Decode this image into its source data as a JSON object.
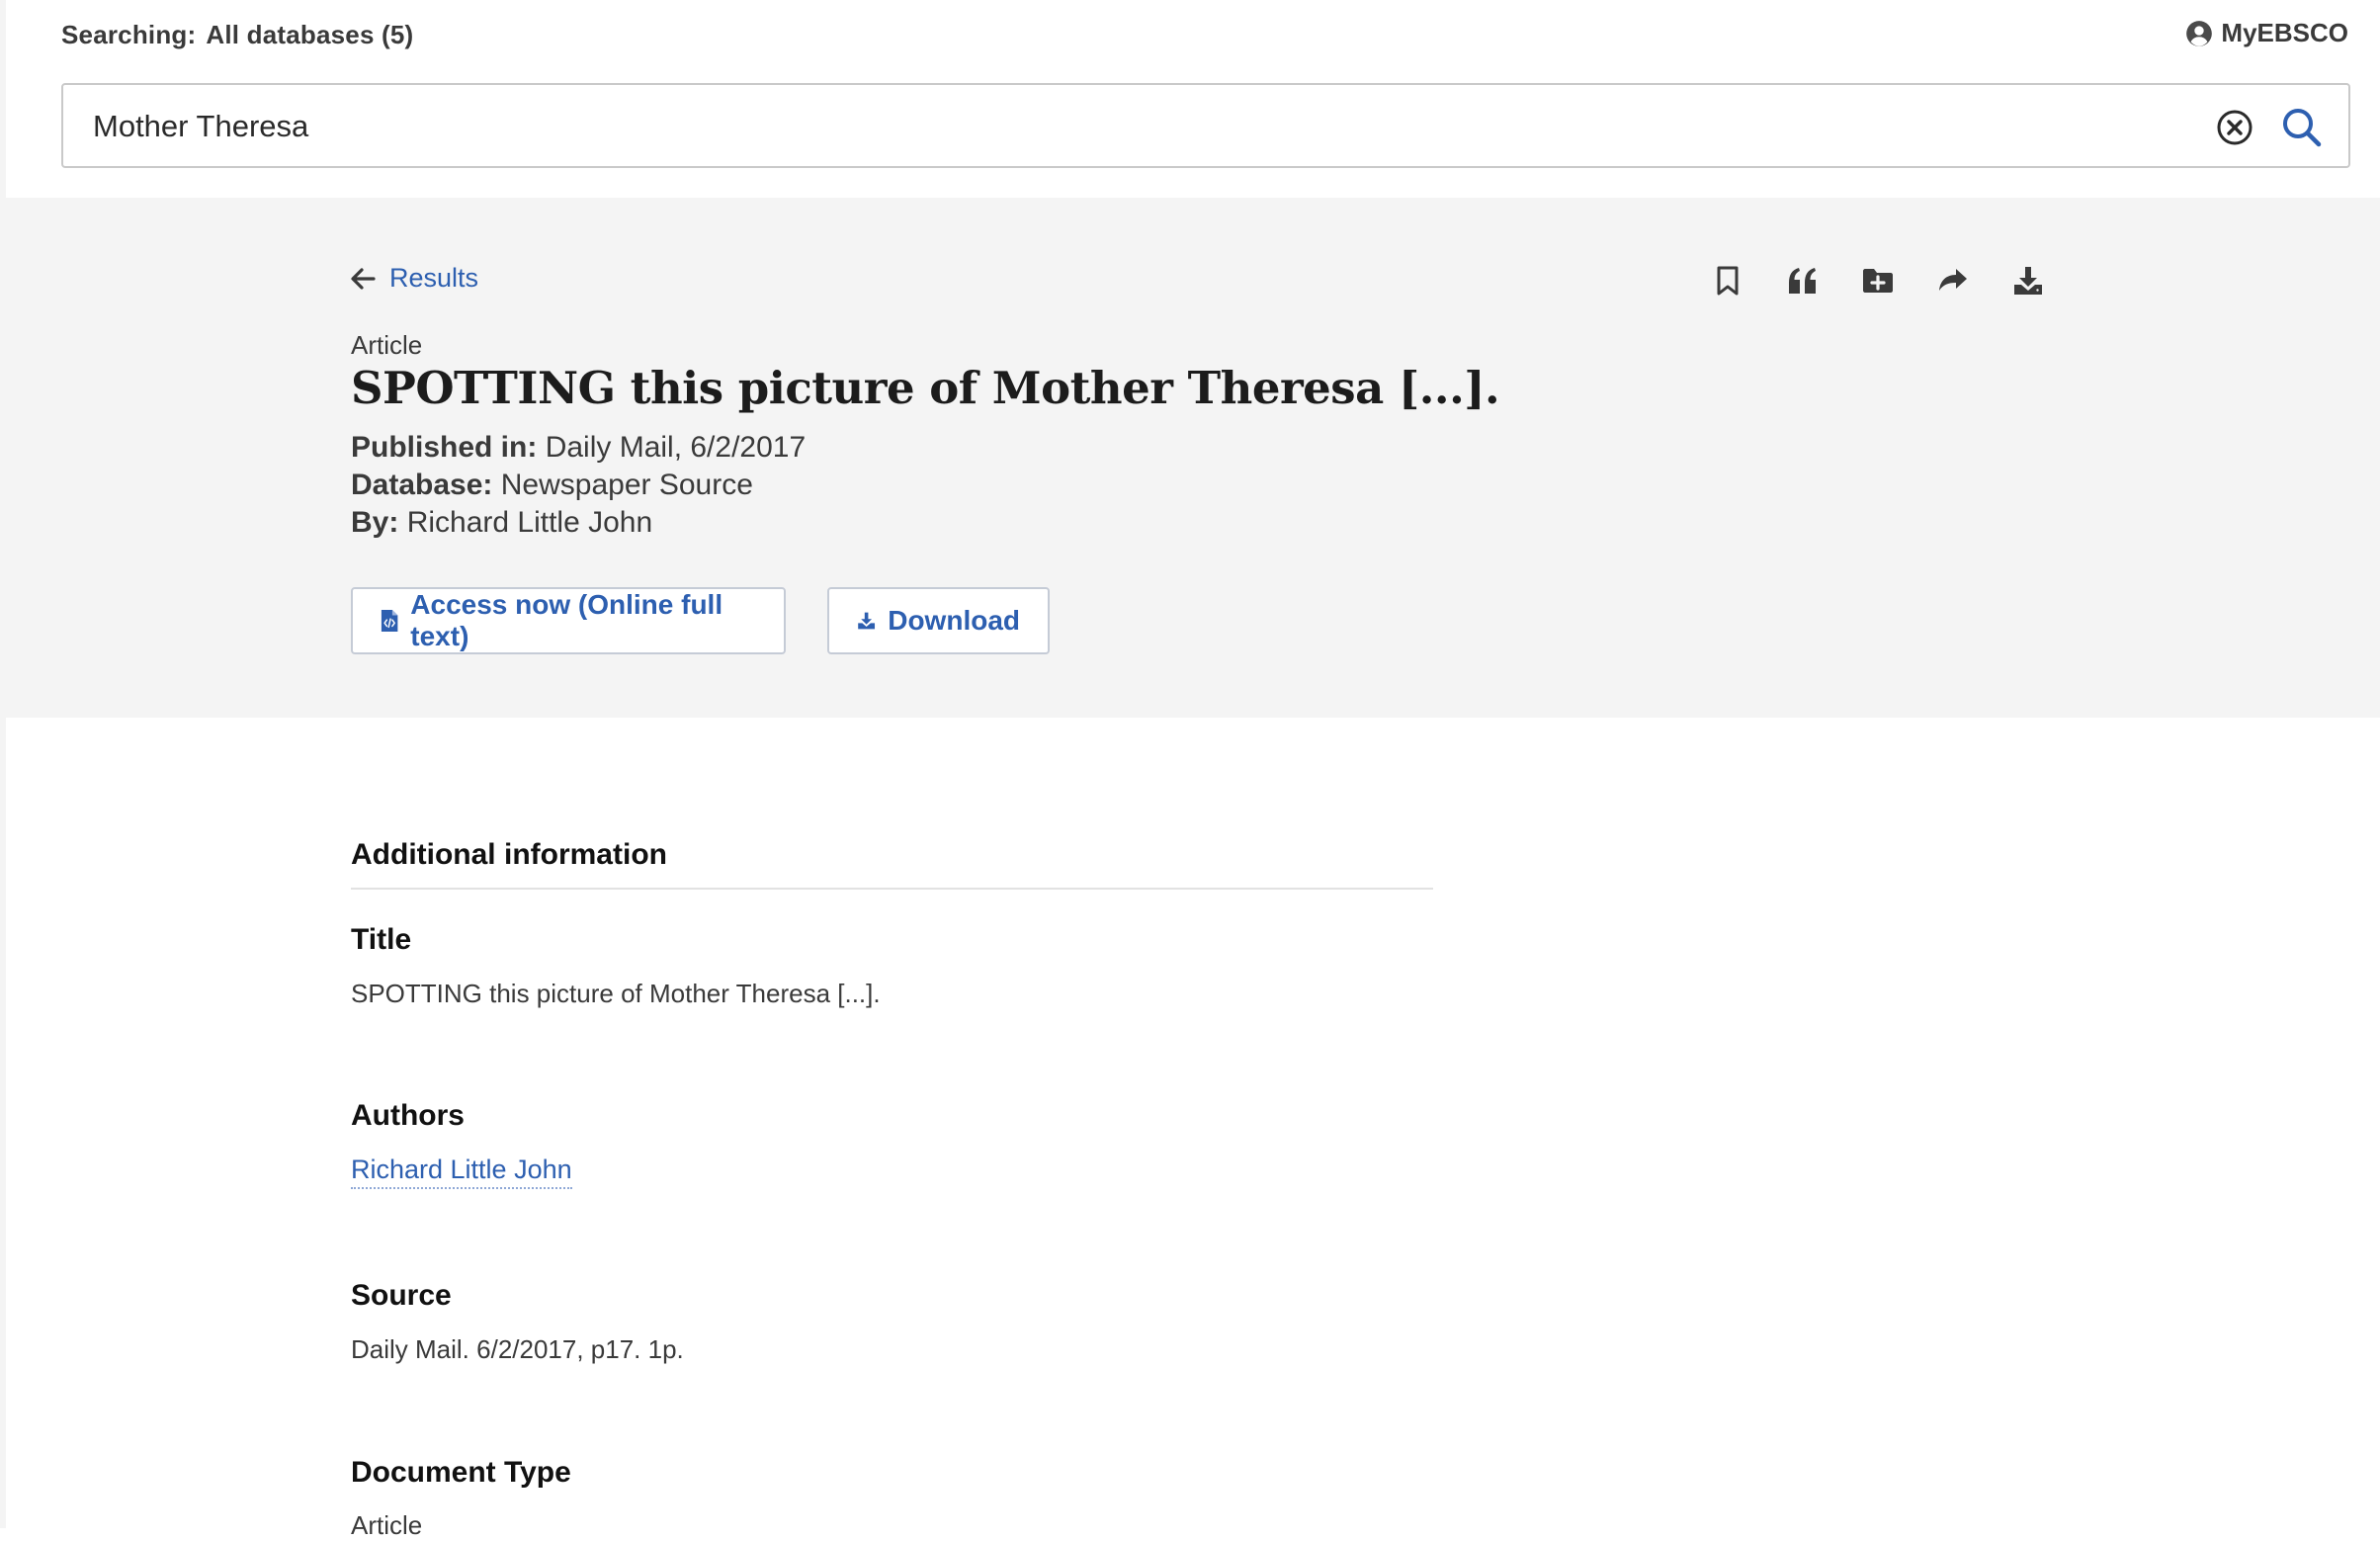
{
  "header": {
    "searching_label": "Searching:",
    "searching_value": "All databases (5)",
    "account_label": "MyEBSCO"
  },
  "search": {
    "query": "Mother Theresa",
    "clear_icon": "clear-circle-icon",
    "search_icon": "search-icon"
  },
  "record": {
    "back_label": "Results",
    "publication_type": "Article",
    "title": "SPOTTING this picture of Mother Theresa [...].",
    "published_in_label": "Published in:",
    "published_in_value": "Daily Mail, 6/2/2017",
    "database_label": "Database:",
    "database_value": "Newspaper Source",
    "by_label": "By:",
    "by_value": "Richard Little John",
    "access_button": "Access now (Online full text)",
    "download_button": "Download",
    "tools": [
      "bookmark-icon",
      "cite-quote-icon",
      "add-to-folder-icon",
      "share-icon",
      "download-icon"
    ]
  },
  "additional_info": {
    "heading": "Additional information",
    "fields": [
      {
        "label": "Title",
        "value": "SPOTTING this picture of Mother Theresa [...]."
      },
      {
        "label": "Authors",
        "value": "Richard Little John"
      },
      {
        "label": "Source",
        "value": "Daily Mail. 6/2/2017, p17. 1p."
      },
      {
        "label": "Document Type",
        "value": "Article"
      }
    ]
  },
  "colors": {
    "accent": "#2d5fb0",
    "hero_background": "#f4f4f4",
    "text": "#3a3a3a"
  }
}
